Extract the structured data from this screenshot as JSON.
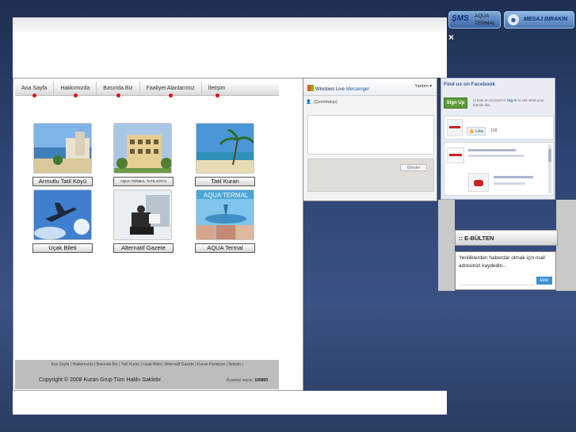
{
  "nav": {
    "items": [
      "Ana Sayfa",
      "Hakkımızda",
      "Basında Biz",
      "Faaliyet Alanlarımız",
      "İletişim"
    ]
  },
  "tiles": [
    {
      "label": "Armutlu Tatil Köyü",
      "image": "beach-resort-photo"
    },
    {
      "label": "AQUA TERMAL TATİL KÖYÜ",
      "image": "hotel-building-photo"
    },
    {
      "label": "Tatil Kuran",
      "image": "tropical-beach-photo"
    },
    {
      "label": "Uçak Bileti",
      "image": "airplane-sky-photo"
    },
    {
      "label": "Alternatif Gazete",
      "image": "reading-newspaper-photo"
    },
    {
      "label": "AQUA Termal",
      "image": "spa-fountain-photo"
    }
  ],
  "tile_banner_text": "AQUA TERMAL",
  "footer": {
    "links": "Ana Sayfa | Hakkımızda | Basında Biz | Tatil Kuran | Uçak Bileti | Alternatif Gazete | Kuran Pansiyon | İletişim |",
    "copyright": "Copyright © 2008 Kuran Grup Tüm Hakkı Saklıdır.",
    "visitor_label": "Ziyaretçi sayısı:",
    "visitor_count": "100869"
  },
  "messenger": {
    "logo": "Windows Live",
    "logo_sub": "Messenger",
    "help": "Yardım ▾",
    "status": "(Çevrimdışı)",
    "send": "Gönder"
  },
  "top_buttons": {
    "aqua_logo": "ŞMS",
    "aqua_line1": "AQUA",
    "aqua_line2": "TERMAL",
    "message": "MESAJ BIRAKIN",
    "close": "×"
  },
  "facebook": {
    "title": "Find us on Facebook",
    "signup": "Sign Up",
    "signup_text_a": "Create an account or",
    "signup_login": "log in",
    "signup_text_b": "to see what your friends like.",
    "like": "👍 Like",
    "like_count": "218"
  },
  "bulten": {
    "title": ":: E-BÜLTEN",
    "text": "Yeniliklerden haberdar olmak için mail adresinizi kaydedin...",
    "button": "Ekle"
  }
}
